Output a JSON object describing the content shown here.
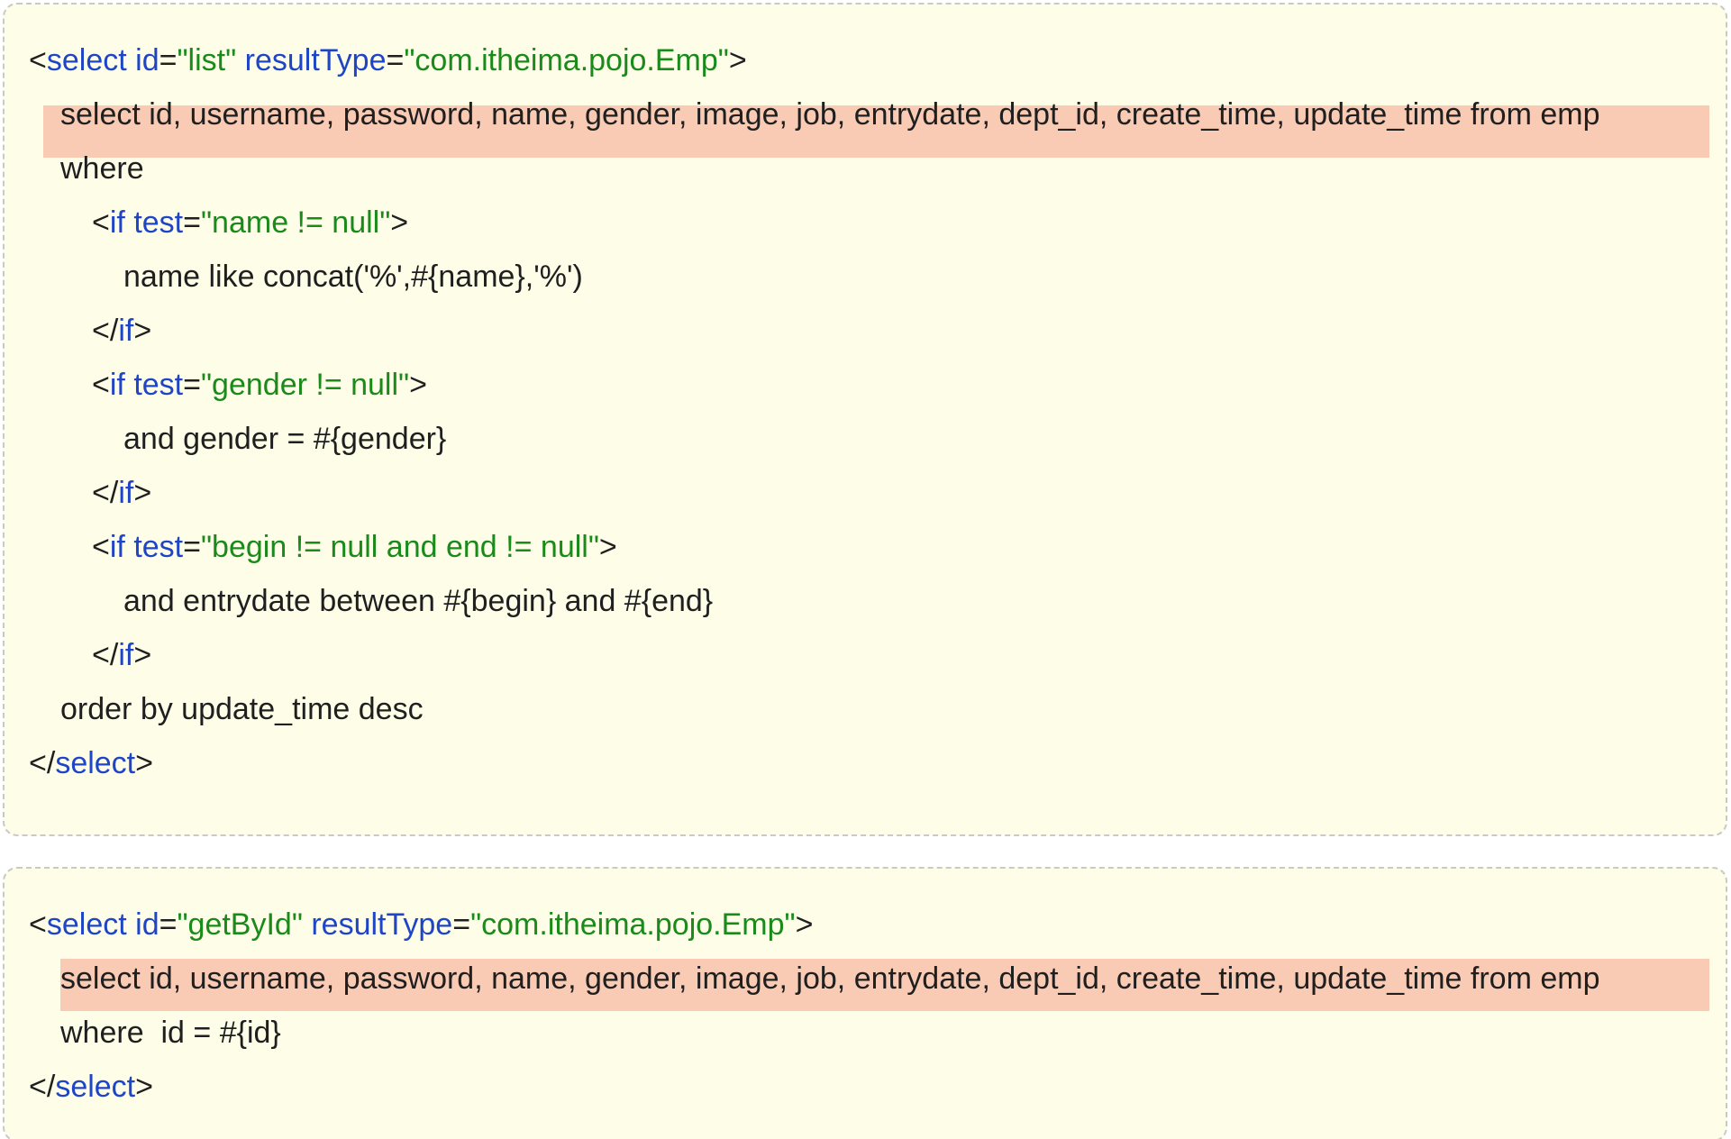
{
  "colors": {
    "background": "#fefee8",
    "border": "#c9c9c9",
    "highlight": "#f9cbb4",
    "tag": "#1f45c7",
    "value": "#1a8a1a",
    "text": "#1f1f1f"
  },
  "blocks": [
    {
      "lines": [
        {
          "indent": 0,
          "highlight": false,
          "tokens": [
            {
              "t": "punc",
              "s": "<"
            },
            {
              "t": "tag",
              "s": "select"
            },
            {
              "t": "text",
              "s": " "
            },
            {
              "t": "attr",
              "s": "id"
            },
            {
              "t": "punc",
              "s": "="
            },
            {
              "t": "val",
              "s": "\"list\""
            },
            {
              "t": "text",
              "s": " "
            },
            {
              "t": "attr",
              "s": "resultType"
            },
            {
              "t": "punc",
              "s": "="
            },
            {
              "t": "val",
              "s": "\"com.itheima.pojo.Emp\""
            },
            {
              "t": "punc",
              "s": ">"
            }
          ]
        },
        {
          "indent": 1,
          "highlight": true,
          "tokens": [
            {
              "t": "text",
              "s": "select id, username, password, name, gender, image, job, entrydate, dept_id, create_time, update_time from emp"
            }
          ]
        },
        {
          "indent": 1,
          "highlight": false,
          "tokens": [
            {
              "t": "text",
              "s": "where"
            }
          ]
        },
        {
          "indent": 2,
          "highlight": false,
          "tokens": [
            {
              "t": "punc",
              "s": "<"
            },
            {
              "t": "tag",
              "s": "if"
            },
            {
              "t": "text",
              "s": " "
            },
            {
              "t": "attr",
              "s": "test"
            },
            {
              "t": "punc",
              "s": "="
            },
            {
              "t": "val",
              "s": "\"name != null\""
            },
            {
              "t": "punc",
              "s": ">"
            }
          ]
        },
        {
          "indent": 3,
          "highlight": false,
          "tokens": [
            {
              "t": "text",
              "s": "name like concat('%',#{name},'%')"
            }
          ]
        },
        {
          "indent": 2,
          "highlight": false,
          "tokens": [
            {
              "t": "punc",
              "s": "</"
            },
            {
              "t": "tag",
              "s": "if"
            },
            {
              "t": "punc",
              "s": ">"
            }
          ]
        },
        {
          "indent": 2,
          "highlight": false,
          "tokens": [
            {
              "t": "punc",
              "s": "<"
            },
            {
              "t": "tag",
              "s": "if"
            },
            {
              "t": "text",
              "s": " "
            },
            {
              "t": "attr",
              "s": "test"
            },
            {
              "t": "punc",
              "s": "="
            },
            {
              "t": "val",
              "s": "\"gender != null\""
            },
            {
              "t": "punc",
              "s": ">"
            }
          ]
        },
        {
          "indent": 3,
          "highlight": false,
          "tokens": [
            {
              "t": "text",
              "s": "and gender = #{gender}"
            }
          ]
        },
        {
          "indent": 2,
          "highlight": false,
          "tokens": [
            {
              "t": "punc",
              "s": "</"
            },
            {
              "t": "tag",
              "s": "if"
            },
            {
              "t": "punc",
              "s": ">"
            }
          ]
        },
        {
          "indent": 2,
          "highlight": false,
          "tokens": [
            {
              "t": "punc",
              "s": "<"
            },
            {
              "t": "tag",
              "s": "if"
            },
            {
              "t": "text",
              "s": " "
            },
            {
              "t": "attr",
              "s": "test"
            },
            {
              "t": "punc",
              "s": "="
            },
            {
              "t": "val",
              "s": "\"begin != null and end != null\""
            },
            {
              "t": "punc",
              "s": ">"
            }
          ]
        },
        {
          "indent": 3,
          "highlight": false,
          "tokens": [
            {
              "t": "text",
              "s": "and entrydate between #{begin} and #{end}"
            }
          ]
        },
        {
          "indent": 2,
          "highlight": false,
          "tokens": [
            {
              "t": "punc",
              "s": "</"
            },
            {
              "t": "tag",
              "s": "if"
            },
            {
              "t": "punc",
              "s": ">"
            }
          ]
        },
        {
          "indent": 1,
          "highlight": false,
          "tokens": [
            {
              "t": "text",
              "s": "order by update_time desc"
            }
          ]
        },
        {
          "indent": 0,
          "highlight": false,
          "tokens": [
            {
              "t": "punc",
              "s": "</"
            },
            {
              "t": "tag",
              "s": "select"
            },
            {
              "t": "punc",
              "s": ">"
            }
          ]
        }
      ]
    },
    {
      "lines": [
        {
          "indent": 0,
          "highlight": false,
          "tokens": [
            {
              "t": "punc",
              "s": "<"
            },
            {
              "t": "tag",
              "s": "select"
            },
            {
              "t": "text",
              "s": " "
            },
            {
              "t": "attr",
              "s": "id"
            },
            {
              "t": "punc",
              "s": "="
            },
            {
              "t": "val",
              "s": "\"getById\""
            },
            {
              "t": "text",
              "s": " "
            },
            {
              "t": "attr",
              "s": "resultType"
            },
            {
              "t": "punc",
              "s": "="
            },
            {
              "t": "val",
              "s": "\"com.itheima.pojo.Emp\""
            },
            {
              "t": "punc",
              "s": ">"
            }
          ]
        },
        {
          "indent": 1,
          "highlight": true,
          "tokens": [
            {
              "t": "text",
              "s": "select id, username, password, name, gender, image, job, entrydate, dept_id, create_time, update_time from emp"
            }
          ]
        },
        {
          "indent": 1,
          "highlight": false,
          "tokens": [
            {
              "t": "text",
              "s": "where  id = #{id}"
            }
          ]
        },
        {
          "indent": 0,
          "highlight": false,
          "tokens": [
            {
              "t": "punc",
              "s": "</"
            },
            {
              "t": "tag",
              "s": "select"
            },
            {
              "t": "punc",
              "s": ">"
            }
          ]
        }
      ]
    }
  ]
}
